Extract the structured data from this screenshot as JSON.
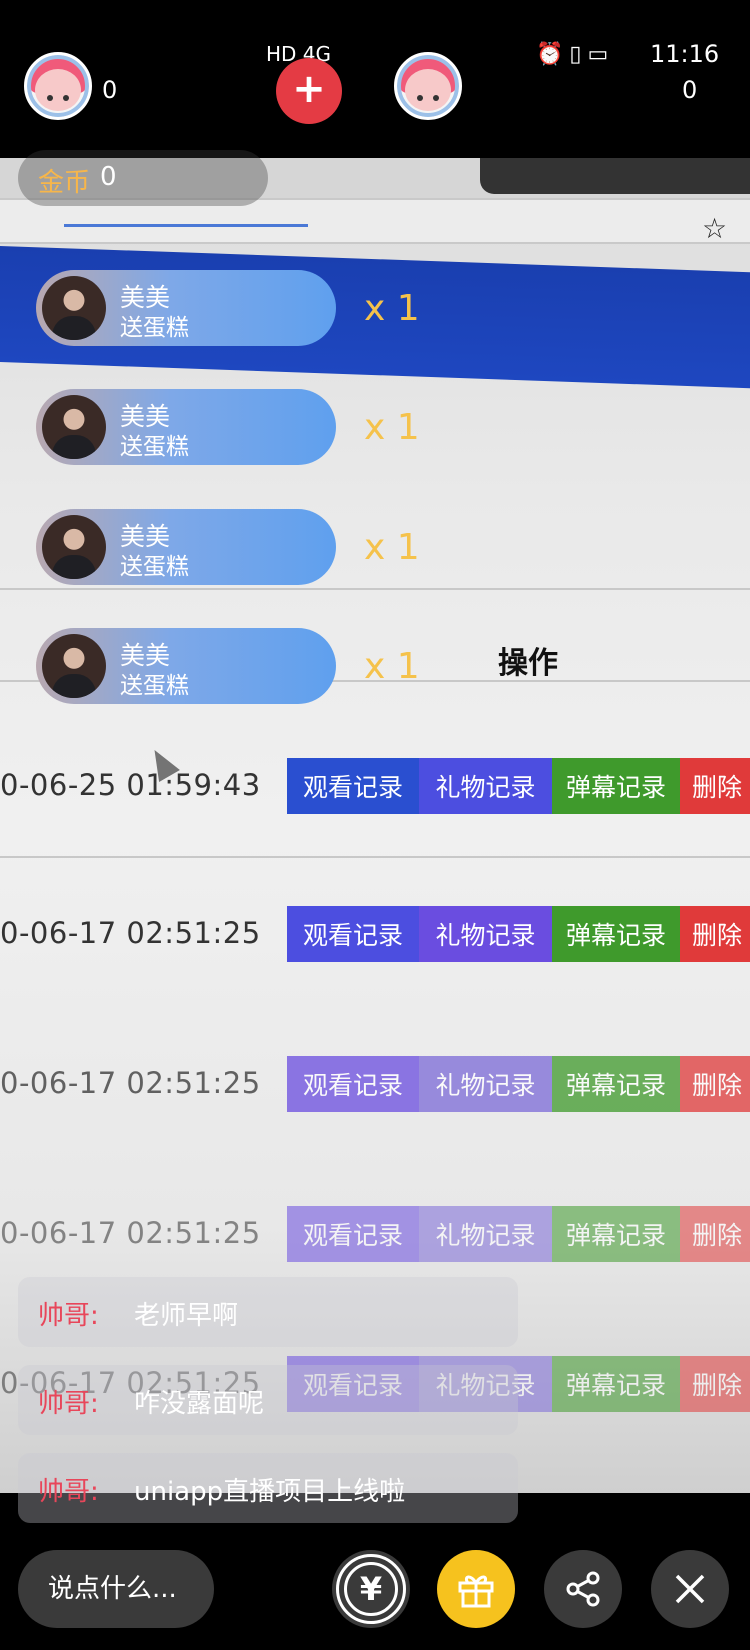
{
  "status_bar": {
    "network": "HD 4G",
    "time": "11:16"
  },
  "top_bar": {
    "left_count": "0",
    "plus_label": "+",
    "right_count": "0",
    "coin_label": "金币",
    "coin_value": "0"
  },
  "gifts": [
    {
      "name": "美美",
      "text": "送蛋糕",
      "count": "x 1"
    },
    {
      "name": "美美",
      "text": "送蛋糕",
      "count": "x 1"
    },
    {
      "name": "美美",
      "text": "送蛋糕",
      "count": "x 1"
    },
    {
      "name": "美美",
      "text": "送蛋糕",
      "count": "x 1"
    }
  ],
  "scene": {
    "op_header": "操作",
    "rows": [
      {
        "date": "0-06-25 01:59:43",
        "b1": "观看记录",
        "b2": "礼物记录",
        "b3": "弹幕记录",
        "b4": "删除"
      },
      {
        "date": "0-06-17 02:51:25",
        "b1": "观看记录",
        "b2": "礼物记录",
        "b3": "弹幕记录",
        "b4": "删除"
      },
      {
        "date": "0-06-17 02:51:25",
        "b1": "观看记录",
        "b2": "礼物记录",
        "b3": "弹幕记录",
        "b4": "删除"
      },
      {
        "date": "0-06-17 02:51:25",
        "b1": "观看记录",
        "b2": "礼物记录",
        "b3": "弹幕记录",
        "b4": "删除"
      },
      {
        "date": "0-06-17 02:51:25",
        "b1": "观看记录",
        "b2": "礼物记录",
        "b3": "弹幕记录",
        "b4": "删除"
      }
    ]
  },
  "chat": [
    {
      "user": "帅哥:",
      "msg": "老师早啊"
    },
    {
      "user": "帅哥:",
      "msg": "咋没露面呢"
    },
    {
      "user": "帅哥:",
      "msg": "uniapp直播项目上线啦"
    }
  ],
  "bottom_bar": {
    "input_placeholder": "说点什么...",
    "yen_symbol": "¥"
  },
  "colors": {
    "accent_red": "#e43b44",
    "coin_gold": "#f7b64a",
    "gift_yellow": "#f6c21e",
    "chat_user_red": "#e8465a"
  }
}
